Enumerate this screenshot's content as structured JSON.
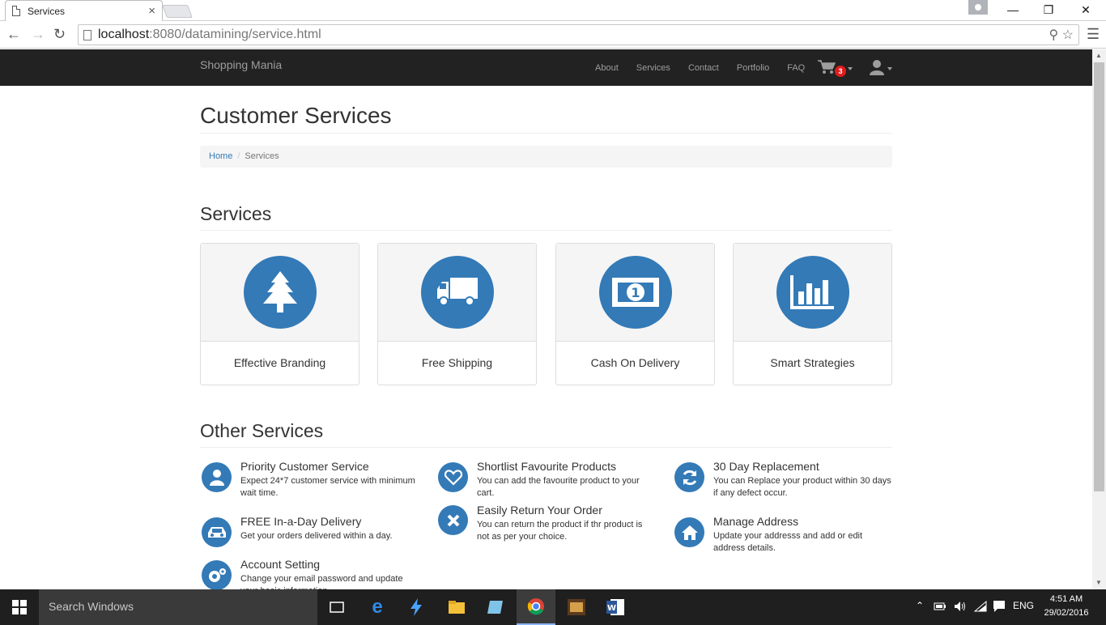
{
  "browser": {
    "tab_title": "Services",
    "tab_close": "×",
    "url_host": "localhost",
    "url_rest": ":8080/datamining/service.html",
    "window_minimize": "—",
    "window_restore": "❐",
    "window_close": "✕"
  },
  "navbar": {
    "brand": "Shopping Mania",
    "links": [
      "About",
      "Services",
      "Contact",
      "Portfolio",
      "FAQ"
    ],
    "cart_count": "3"
  },
  "page": {
    "title": "Customer Services",
    "breadcrumb": {
      "home": "Home",
      "current": "Services"
    }
  },
  "services": {
    "heading": "Services",
    "cards": [
      {
        "label": "Effective Branding",
        "icon": "tree-icon"
      },
      {
        "label": "Free Shipping",
        "icon": "truck-icon"
      },
      {
        "label": "Cash On Delivery",
        "icon": "money-icon"
      },
      {
        "label": "Smart Strategies",
        "icon": "bar-chart-icon"
      }
    ]
  },
  "other_services": {
    "heading": "Other Services",
    "items": [
      {
        "title": "Priority Customer Service",
        "desc": "Expect 24*7 customer service with minimum wait time.",
        "icon": "user-icon"
      },
      {
        "title": "Shortlist Favourite Products",
        "desc": "You can add the favourite product to your cart.",
        "icon": "heart-icon"
      },
      {
        "title": "30 Day Replacement",
        "desc": "You can Replace your product within 30 days if any defect occur.",
        "icon": "refresh-icon"
      },
      {
        "title": "FREE In-a-Day Delivery",
        "desc": "Get your orders delivered within a day.",
        "icon": "car-icon"
      },
      {
        "title": "Easily Return Your Order",
        "desc": "You can return the product if thr product is not as per your choice.",
        "icon": "close-icon"
      },
      {
        "title": "Manage Address",
        "desc": "Update your addresss and add or edit address details.",
        "icon": "home-icon"
      },
      {
        "title": "Account Setting",
        "desc": "Change your email password and update your basic information.",
        "icon": "gears-icon"
      }
    ]
  },
  "taskbar": {
    "search_placeholder": "Search Windows",
    "language": "ENG",
    "time": "4:51 AM",
    "date": "29/02/2016"
  }
}
